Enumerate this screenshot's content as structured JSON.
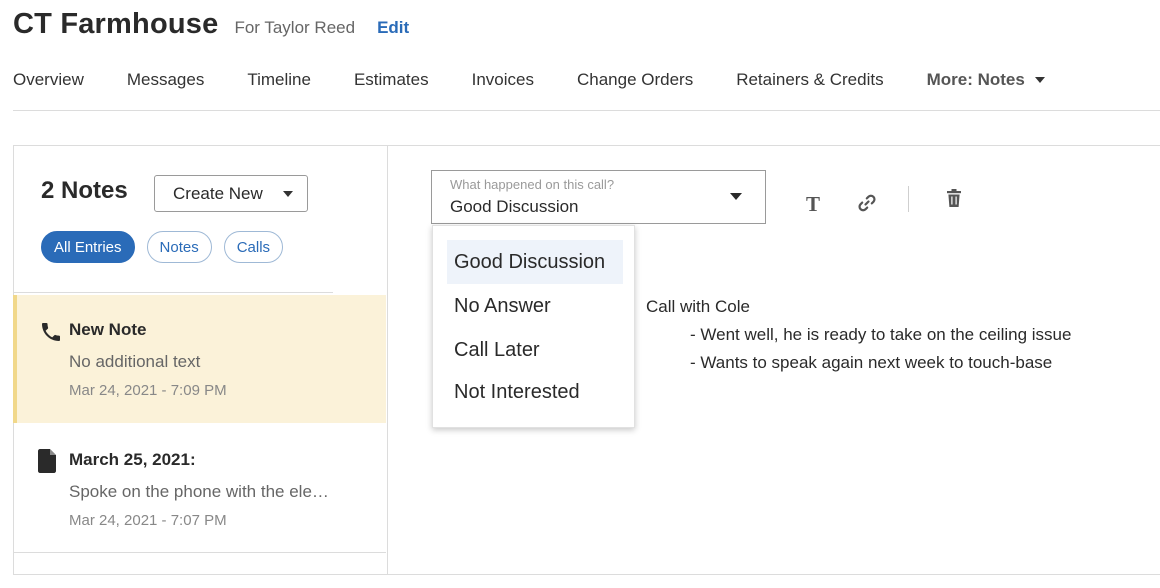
{
  "header": {
    "title": "CT Farmhouse",
    "client": "For Taylor Reed",
    "edit_label": "Edit"
  },
  "tabs": [
    {
      "label": "Overview"
    },
    {
      "label": "Messages"
    },
    {
      "label": "Timeline"
    },
    {
      "label": "Estimates"
    },
    {
      "label": "Invoices"
    },
    {
      "label": "Change Orders"
    },
    {
      "label": "Retainers & Credits"
    },
    {
      "label": "More: Notes",
      "active": true
    }
  ],
  "notes_panel": {
    "count_label": "2 Notes",
    "create_new_label": "Create New",
    "filters": [
      {
        "label": "All Entries",
        "active": true
      },
      {
        "label": "Notes"
      },
      {
        "label": "Calls"
      }
    ],
    "entries": [
      {
        "icon": "phone-icon",
        "title": "New Note",
        "body": "No additional text",
        "date": "Mar 24, 2021 - 7:09 PM",
        "selected": true
      },
      {
        "icon": "document-icon",
        "title": "March 25, 2021:",
        "body": "Spoke on the phone with the ele…",
        "date": "Mar 24, 2021 - 7:07 PM"
      }
    ]
  },
  "editor": {
    "call_outcome": {
      "placeholder": "What happened on this call?",
      "value": "Good Discussion",
      "options": [
        "Good Discussion",
        "No Answer",
        "Call Later",
        "Not Interested"
      ]
    },
    "toolbar": {
      "text_tool_label": "T"
    },
    "note_lines": [
      "Call with Cole",
      "- Went well, he is ready to take on the ceiling issue",
      "-  Wants to speak again next week to touch-base"
    ]
  },
  "colors": {
    "accent": "#2a6bb8",
    "selected_row": "#fbf2d9",
    "selected_border": "#f1d88a"
  }
}
